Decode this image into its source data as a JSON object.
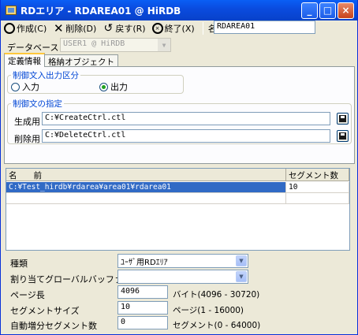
{
  "window": {
    "title": "RDエリア - RDAREA01 @ HiRDB",
    "buttons": {
      "minimize": "_",
      "maximize": "□",
      "close": "×"
    }
  },
  "toolbar": {
    "create_label": "作成(C)",
    "delete_label": "削除(D)",
    "revert_label": "戻す(R)",
    "exit_label": "終了(X)",
    "name_label": "名前",
    "name_value": "RDAREA01"
  },
  "database": {
    "label": "データベース",
    "value": "USER1 @ HiRDB"
  },
  "tabs": [
    {
      "label": "定義情報"
    },
    {
      "label": "格納オブジェクト"
    }
  ],
  "io_group": {
    "title": "制御文入出力区分",
    "options": [
      {
        "label": "入力"
      },
      {
        "label": "出力"
      }
    ]
  },
  "spec_group": {
    "title": "制御文の指定",
    "create_label": "生成用",
    "create_value": "C:¥CreateCtrl.ctl",
    "delete_label": "削除用",
    "delete_value": "C:¥DeleteCtrl.ctl"
  },
  "table": {
    "headers": [
      "名　　前",
      "セグメント数"
    ],
    "rows": [
      {
        "name": "C:¥Test_hirdb¥rdarea¥area01¥rdarea01",
        "segments": "10"
      }
    ]
  },
  "settings": {
    "type_label": "種類",
    "type_value": "ﾕｰｻﾞ用RDｴﾘｱ",
    "buffer_label": "割り当てグローバルバッファ名",
    "buffer_value": "",
    "page_length_label": "ページ長",
    "page_length_value": "4096",
    "page_length_unit": "バイト(4096 - 30720)",
    "segment_size_label": "セグメントサイズ",
    "segment_size_value": "10",
    "segment_size_unit": "ページ(1 - 16000)",
    "auto_inc_label": "自動増分セグメント数",
    "auto_inc_value": "0",
    "auto_inc_unit": "セグメント(0 - 64000)"
  }
}
